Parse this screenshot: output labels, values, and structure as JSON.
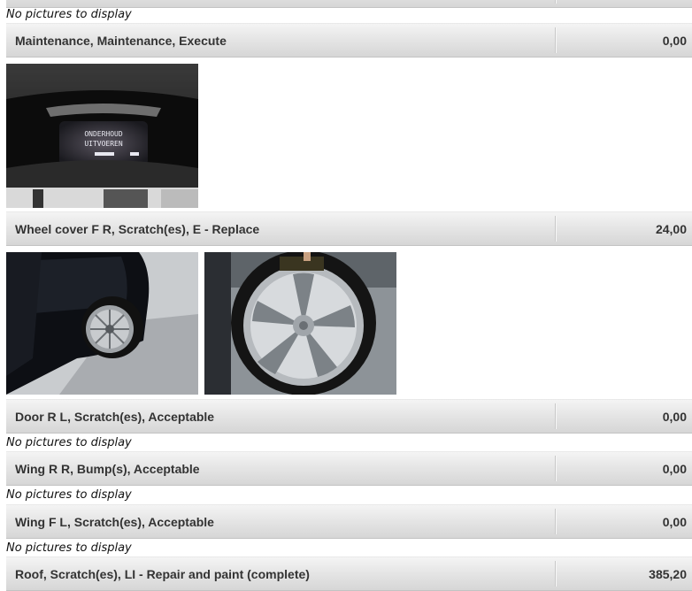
{
  "top_partial": {
    "amount": ""
  },
  "no_pictures_text": "No pictures to display",
  "items": [
    {
      "description": "Maintenance, Maintenance, Execute",
      "amount": "0,00"
    },
    {
      "description": "Wheel cover F R, Scratch(es), E - Replace",
      "amount": "24,00"
    },
    {
      "description": "Door R L, Scratch(es), Acceptable",
      "amount": "0,00"
    },
    {
      "description": "Wing R R, Bump(s), Acceptable",
      "amount": "0,00"
    },
    {
      "description": "Wing F L, Scratch(es), Acceptable",
      "amount": "0,00"
    },
    {
      "description": "Roof, Scratch(es), LI - Repair and paint (complete)",
      "amount": "385,20"
    }
  ],
  "photos": {
    "dashboard_text_line1": "ONDERHOUD",
    "dashboard_text_line2": "UITVOEREN"
  }
}
